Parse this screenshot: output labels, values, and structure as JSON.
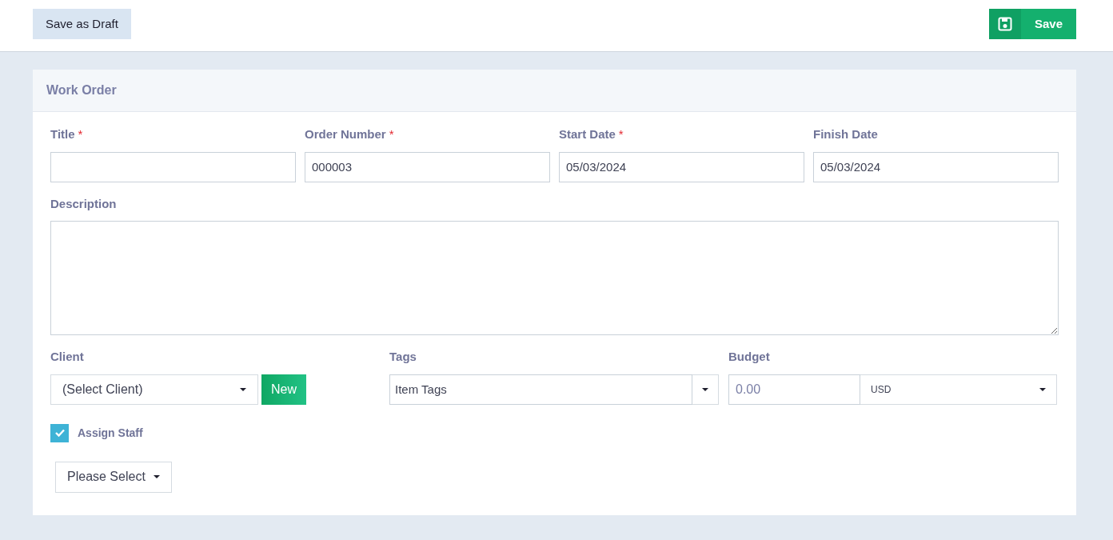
{
  "toolbar": {
    "draft_button": "Save as Draft",
    "save_button": "Save"
  },
  "card": {
    "title": "Work Order"
  },
  "fields": [
    {
      "label": "Title",
      "required_mark": "*"
    },
    {
      "label": "Order Number",
      "required_mark": "*",
      "value": "000003"
    },
    {
      "label": "Start Date",
      "required_mark": "*",
      "value": "05/03/2024"
    },
    {
      "label": "Finish Date",
      "value": "05/03/2024"
    }
  ],
  "description": {
    "label": "Description"
  },
  "client": {
    "label": "Client",
    "value": "(Select Client)",
    "new_button": "New"
  },
  "tags": {
    "label": "Tags",
    "placeholder": "Item Tags"
  },
  "budget": {
    "label": "Budget",
    "placeholder": "0.00",
    "currency": "USD"
  },
  "assign_staff": {
    "label": "Assign Staff",
    "checked": true
  },
  "staff_select": {
    "label": "Please Select"
  }
}
